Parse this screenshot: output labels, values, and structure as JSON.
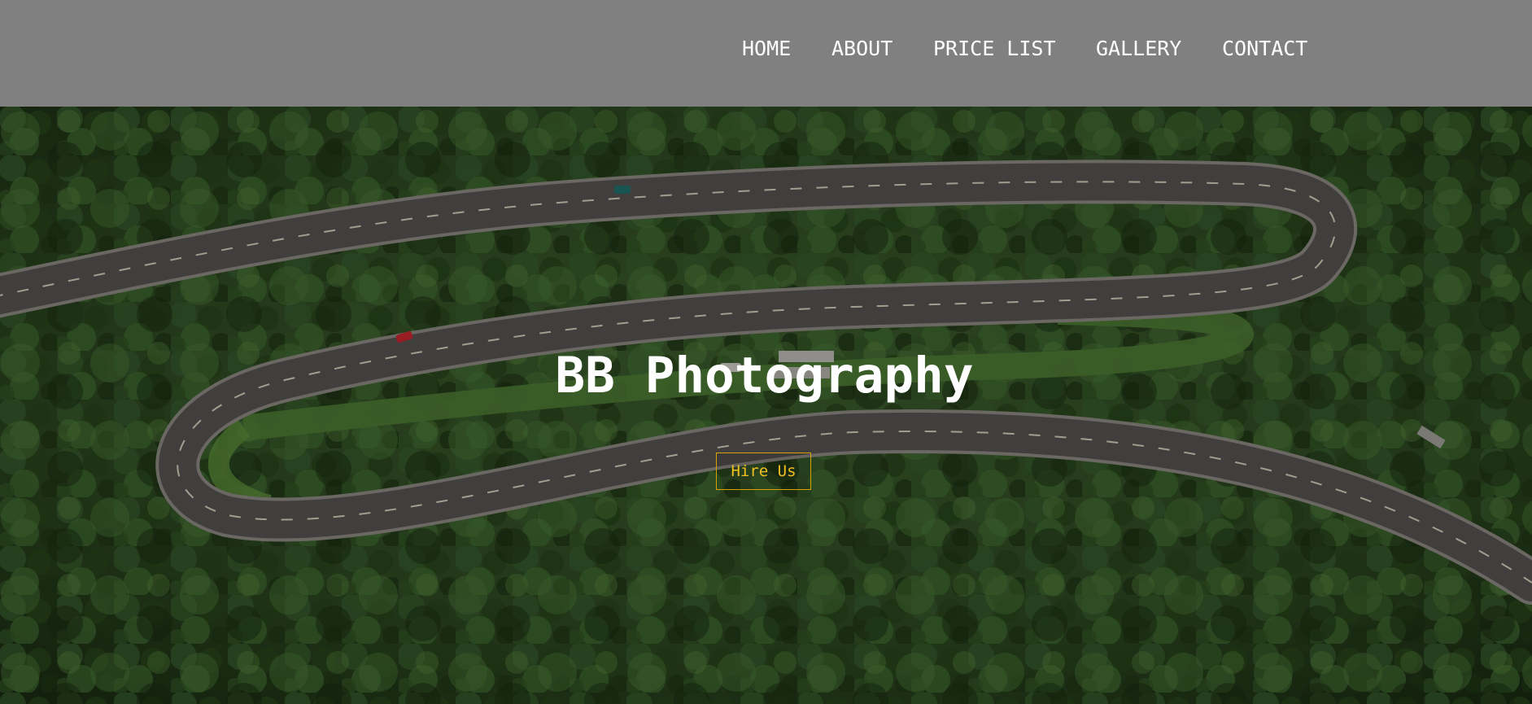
{
  "nav": {
    "items": [
      {
        "label": "HOME"
      },
      {
        "label": "ABOUT"
      },
      {
        "label": "PRICE LIST"
      },
      {
        "label": "GALLERY"
      },
      {
        "label": "CONTACT"
      }
    ]
  },
  "hero": {
    "title": "BB Photography",
    "cta_label": "Hire Us",
    "background_image": "aerial-forest-winding-road"
  },
  "colors": {
    "navbar_bg": "#808080",
    "nav_text": "#ffffff",
    "title_text": "#ffffff",
    "cta_accent": "#f2bf22"
  }
}
